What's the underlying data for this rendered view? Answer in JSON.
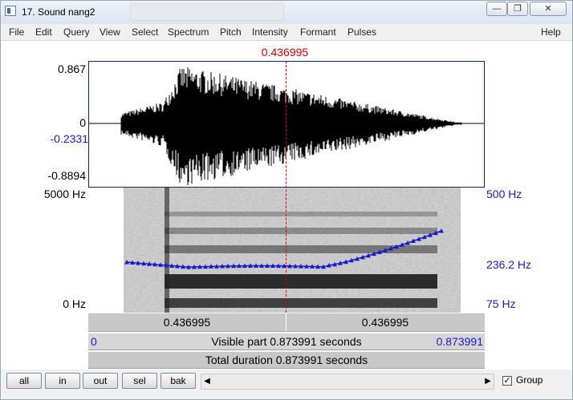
{
  "window": {
    "title": "17. Sound nang2",
    "controls": {
      "minimize": "—",
      "maximize": "❐",
      "close": "✕"
    }
  },
  "menu": [
    "File",
    "Edit",
    "Query",
    "View",
    "Select",
    "Spectrum",
    "Pitch",
    "Intensity",
    "Formant",
    "Pulses",
    "Help"
  ],
  "editor": {
    "cursor_time": "0.436995",
    "waveform": {
      "max_label": "0.867",
      "zero_label": "0",
      "cursor_value_label": "-0.2331",
      "min_label": "-0.8894"
    },
    "spectrogram": {
      "freq_top_label": "5000 Hz",
      "freq_bottom_label": "0 Hz",
      "pitch_top_label": "500 Hz",
      "pitch_cursor_label": "236.2 Hz",
      "pitch_bottom_label": "75 Hz"
    },
    "time_bar": {
      "left_segment": "0.436995",
      "right_segment": "0.436995"
    },
    "visible_bar": {
      "start": "0",
      "text": "Visible part 0.873991 seconds",
      "end": "0.873991"
    },
    "total_bar": {
      "text": "Total duration 0.873991 seconds"
    }
  },
  "controls": {
    "zoom_buttons": [
      "all",
      "in",
      "out",
      "sel",
      "bak"
    ],
    "group": {
      "label": "Group",
      "checked": true
    }
  },
  "colors": {
    "cursor": "#d00000",
    "pitch": "#1a1acd"
  },
  "icons": {
    "scroll_left": "◀",
    "scroll_right": "▶",
    "check": "✓"
  }
}
